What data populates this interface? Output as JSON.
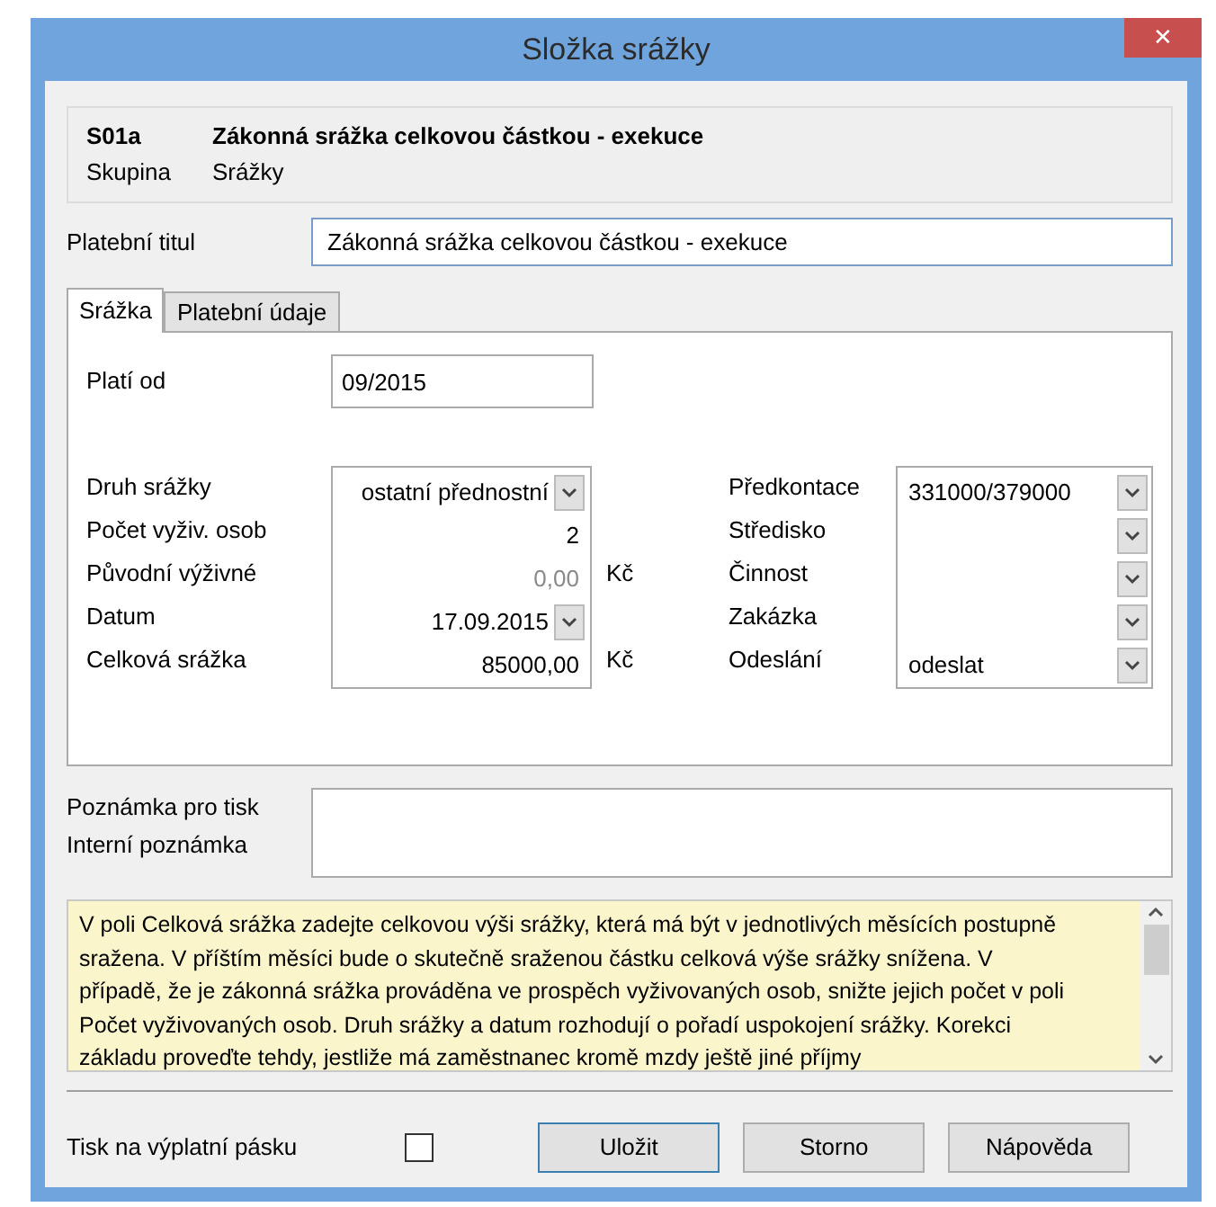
{
  "window": {
    "title": "Složka srážky",
    "close": "✕"
  },
  "header": {
    "code": "S01a",
    "name": "Zákonná srážka celkovou částkou - exekuce",
    "group_label": "Skupina",
    "group_value": "Srážky"
  },
  "payment_title": {
    "label": "Platební titul",
    "value": "Zákonná srážka celkovou částkou - exekuce"
  },
  "tabs": [
    {
      "label": "Srážka",
      "selected": true
    },
    {
      "label": "Platební údaje",
      "selected": false
    }
  ],
  "valid_from": {
    "label": "Platí od",
    "value": "09/2015"
  },
  "left_fields": [
    {
      "label": "Druh srážky",
      "value": "ostatní přednostní",
      "kind": "dropdown",
      "disabled": false
    },
    {
      "label": "Počet vyživ. osob",
      "value": "2",
      "kind": "number",
      "disabled": false
    },
    {
      "label": "Původní výživné",
      "value": "0,00",
      "kind": "number",
      "disabled": true,
      "unit": "Kč"
    },
    {
      "label": "Datum",
      "value": "17.09.2015",
      "kind": "dropdown",
      "disabled": false
    },
    {
      "label": "Celková srážka",
      "value": "85000,00",
      "kind": "number",
      "disabled": false,
      "unit": "Kč"
    }
  ],
  "right_fields": [
    {
      "label": "Předkontace",
      "value": "331000/379000"
    },
    {
      "label": "Středisko"
    },
    {
      "label": "Činnost"
    },
    {
      "label": "Zakázka"
    },
    {
      "label": "Odeslání",
      "value": "odeslat"
    }
  ],
  "note_labels": [
    "Poznámka pro tisk",
    "Interní poznámka"
  ],
  "help_text": "V poli Celková srážka zadejte celkovou výši srážky, která má být v jednotlivých měsících postupně sražena. V příštím měsíci bude o skutečně sraženou částku celková výše srážky snížena. V případě, že je zákonná srážka prováděna ve prospěch vyživovaných osob, snižte jejich počet v poli Počet vyživovaných osob. Druh srážky a datum rozhodují o pořadí uspokojení srážky. Korekci základu proveďte tehdy, jestliže má zaměstnanec kromě mzdy ještě jiné příjmy",
  "print_on_slip": {
    "label": "Tisk na výplatní pásku",
    "checked": false
  },
  "buttons": [
    {
      "label": "Uložit",
      "default": true
    },
    {
      "label": "Storno",
      "default": false
    },
    {
      "label": "Nápověda",
      "default": false
    }
  ]
}
